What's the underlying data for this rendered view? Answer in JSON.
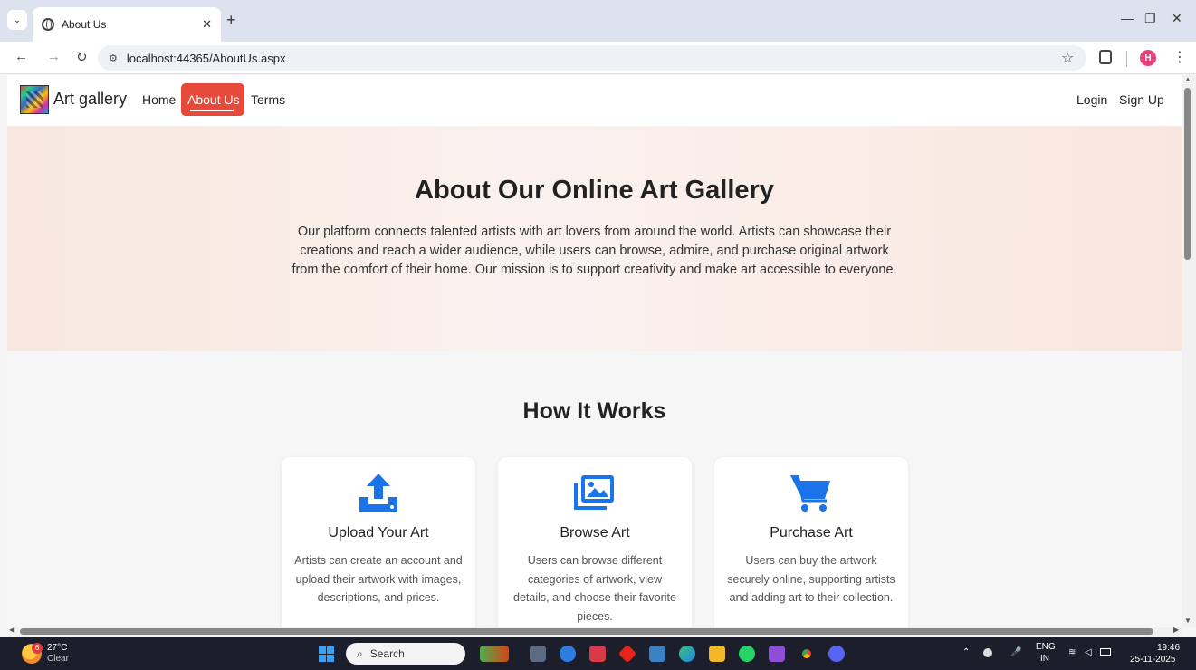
{
  "browser": {
    "tab_title": "About Us",
    "tab_close": "✕",
    "new_tab": "+",
    "url": "localhost:44365/AboutUs.aspx",
    "profile_initial": "H",
    "window_controls": {
      "minimize": "—",
      "restore": "❐",
      "close": "✕"
    }
  },
  "site": {
    "brand": "Art gallery",
    "nav": {
      "home": "Home",
      "about": "About Us",
      "terms": "Terms",
      "login": "Login",
      "signup": "Sign Up"
    },
    "accent_color": "#e64a3b"
  },
  "hero": {
    "title": "About Our Online Art Gallery",
    "text": "Our platform connects talented artists with art lovers from around the world. Artists can showcase their creations and reach a wider audience, while users can browse, admire, and purchase original artwork from the comfort of their home. Our mission is to support creativity and make art accessible to everyone."
  },
  "how_it_works": {
    "title": "How It Works",
    "icon_color": "#1a73e8",
    "cards": [
      {
        "icon": "upload-icon",
        "title": "Upload Your Art",
        "desc": "Artists can create an account and upload their artwork with images, descriptions, and prices."
      },
      {
        "icon": "gallery-icon",
        "title": "Browse Art",
        "desc": "Users can browse different categories of artwork, view details, and choose their favorite pieces."
      },
      {
        "icon": "cart-icon",
        "title": "Purchase Art",
        "desc": "Users can buy the artwork securely online, supporting artists and adding art to their collection."
      }
    ]
  },
  "taskbar": {
    "weather_badge": "6",
    "temperature": "27°C",
    "condition": "Clear",
    "search_placeholder": "Search",
    "language": "ENG",
    "region": "IN",
    "time": "19:46",
    "date": "25-11-2025"
  }
}
